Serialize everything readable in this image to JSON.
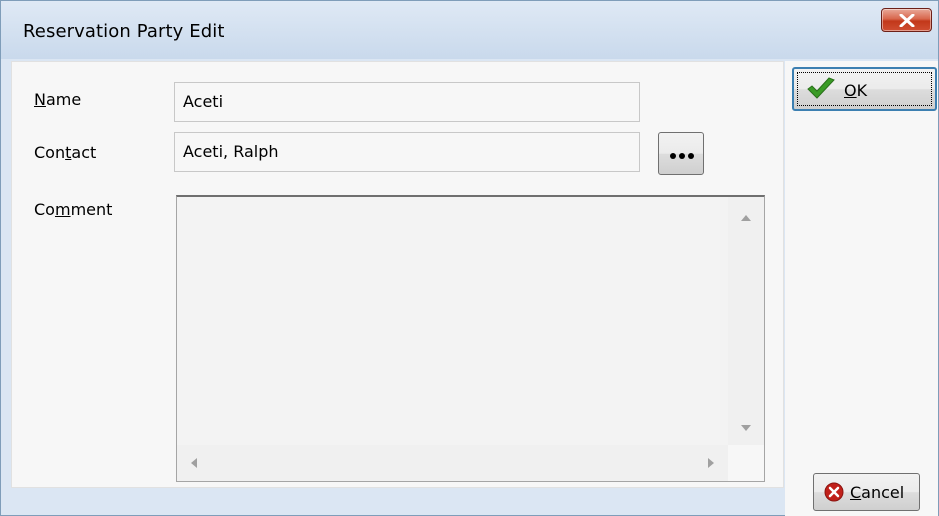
{
  "window": {
    "title": "Reservation Party Edit"
  },
  "form": {
    "name_label": "Name",
    "name_value": "Aceti",
    "contact_label": "Contact",
    "contact_value": "Aceti, Ralph",
    "comment_label": "Comment",
    "comment_value": ""
  },
  "buttons": {
    "ok_label": "OK",
    "cancel_label": "Cancel"
  },
  "icons": {
    "close": "close-icon",
    "ok": "checkmark-icon",
    "cancel": "cancel-circle-icon",
    "lookup": "ellipsis-icon"
  },
  "colors": {
    "close_button": "#c2381a",
    "ok_check": "#3a9b26",
    "cancel_circle": "#c0201a"
  }
}
